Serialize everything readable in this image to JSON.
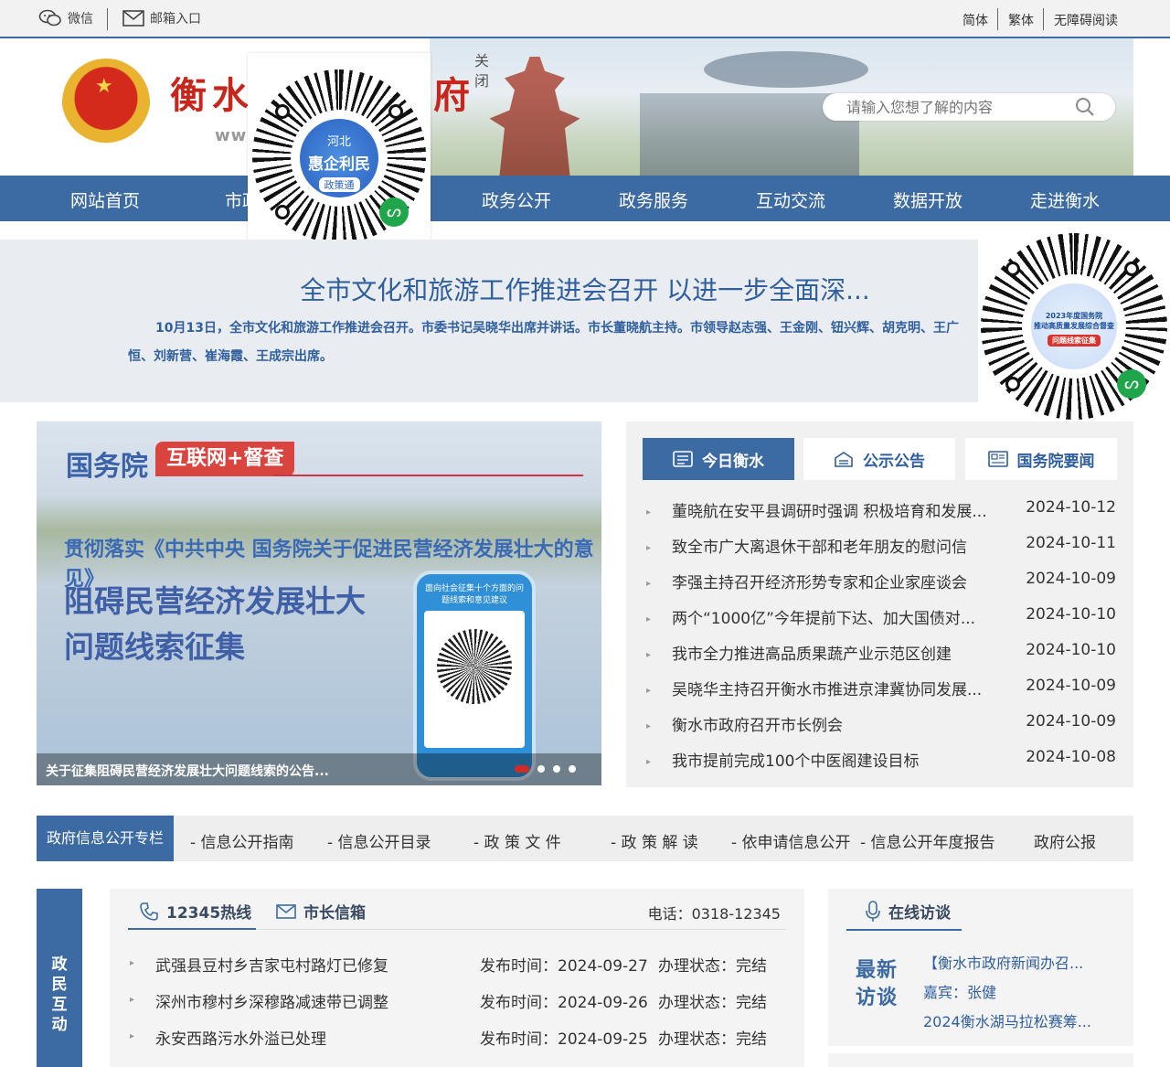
{
  "topbar": {
    "wechat": "微信",
    "mailbox": "邮箱入口",
    "simplified": "简体",
    "traditional": "繁体",
    "accessible": "无障碍阅读"
  },
  "header": {
    "title_start": "衡水",
    "title_end": "府",
    "url_fragment": "www",
    "close": "关闭",
    "search_placeholder": "请输入您想了解的内容"
  },
  "nav": {
    "items": [
      "网站首页",
      "市政",
      "政务公开",
      "政务服务",
      "互动交流",
      "数据开放",
      "走进衡水"
    ]
  },
  "qr_popup": {
    "province": "河北",
    "name": "惠企利民",
    "service": "政策通"
  },
  "qr_side": {
    "line1": "2023年度国务院",
    "line2": "推动高质量发展综合督查",
    "line3": "问题线索征集"
  },
  "headline": {
    "title": "全市文化和旅游工作推进会召开 以进一步全面深...",
    "summary": "10月13日，全市文化和旅游工作推进会召开。市委书记吴晓华出席并讲话。市长董晓航主持。市领导赵志强、王金刚、钮兴辉、胡克明、王广恒、刘新营、崔海霞、王成宗出席。"
  },
  "carousel": {
    "logo": "国务院",
    "badge": "互联网+督查",
    "subtitle": "贯彻落实《中共中央 国务院关于促进民营经济发展壮大的意见》",
    "headline1": "阻碍民营经济发展壮大",
    "headline2": "问题线索征集",
    "phone_text": "面向社会征集十个方面的问题线索和意见建议",
    "caption": "关于征集阻碍民营经济发展壮大问题线索的公告...",
    "active_slide": 1,
    "slide_count": 4
  },
  "news": {
    "tabs": [
      "今日衡水",
      "公示公告",
      "国务院要闻"
    ],
    "items": [
      {
        "title": "董晓航在安平县调研时强调 积极培育和发展...",
        "date": "2024-10-12"
      },
      {
        "title": "致全市广大离退休干部和老年朋友的慰问信",
        "date": "2024-10-11"
      },
      {
        "title": "李强主持召开经济形势专家和企业家座谈会",
        "date": "2024-10-09"
      },
      {
        "title": "两个“1000亿”今年提前下达、加大国债对...",
        "date": "2024-10-10"
      },
      {
        "title": "我市全力推进高品质果蔬产业示范区创建",
        "date": "2024-10-10"
      },
      {
        "title": "吴晓华主持召开衡水市推进京津冀协同发展...",
        "date": "2024-10-09"
      },
      {
        "title": "衡水市政府召开市长例会",
        "date": "2024-10-09"
      },
      {
        "title": "我市提前完成100个中医阁建设目标",
        "date": "2024-10-08"
      }
    ]
  },
  "infobar": {
    "head": "政府信息公开专栏",
    "items": [
      "- 信息公开指南",
      "- 信息公开目录",
      "- 政 策 文 件",
      "- 政 策 解 读",
      "- 依申请信息公开",
      "- 信息公开年度报告",
      "政府公报"
    ]
  },
  "interaction": {
    "side_label": "政民互动",
    "tab_hotline": "12345热线",
    "tab_mayor": "市长信箱",
    "phone": "电话：0318-12345",
    "time_label": "发布时间：",
    "status_label": "办理状态：",
    "rows": [
      {
        "title": "武强县豆村乡吉家屯村路灯已修复",
        "time": "2024-09-27",
        "status": "完结"
      },
      {
        "title": "深州市穆村乡深穆路减速带已调整",
        "time": "2024-09-26",
        "status": "完结"
      },
      {
        "title": "永安西路污水外溢已处理",
        "time": "2024-09-25",
        "status": "完结"
      }
    ]
  },
  "interview": {
    "tab": "在线访谈",
    "badge": "最新访谈",
    "line1": "【衡水市政府新闻办召...",
    "line2": "嘉宾：张健",
    "line3": "2024衡水湖马拉松赛筹..."
  },
  "colors": {
    "primary": "#3c6aa3",
    "title_red": "#c7261c",
    "accent_red": "#d32a24"
  }
}
